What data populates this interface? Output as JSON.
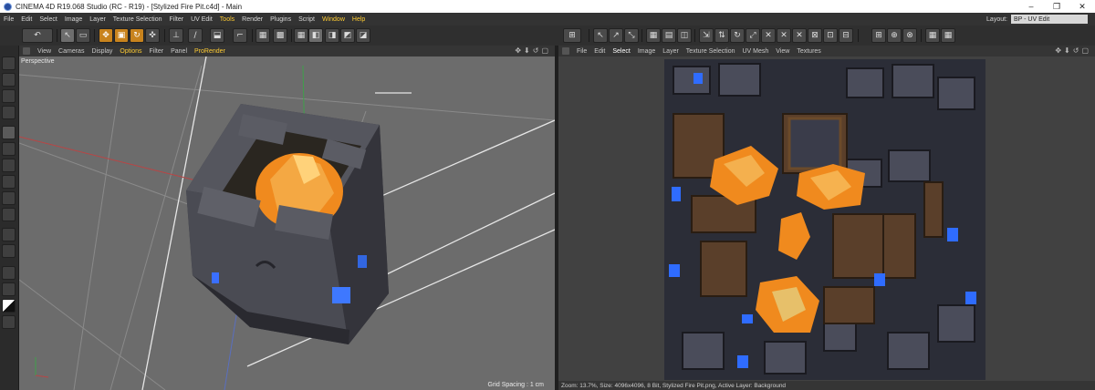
{
  "window": {
    "title": "CINEMA 4D R19.068 Studio (RC - R19) - [Stylized Fire Pit.c4d] - Main",
    "minimize_glyph": "–",
    "maximize_glyph": "❐",
    "close_glyph": "✕"
  },
  "menubar": {
    "items": [
      "File",
      "Edit",
      "Select",
      "Image",
      "Layer",
      "Texture Selection",
      "Filter",
      "UV Edit",
      "Tools",
      "Render",
      "Plugins",
      "Script",
      "Window",
      "Help"
    ],
    "highlighted": [
      "Tools",
      "Window",
      "Help"
    ],
    "layout_label": "Layout:",
    "layout_value": "BP - UV Edit"
  },
  "viewport": {
    "menu": [
      "View",
      "Cameras",
      "Display",
      "Options",
      "Filter",
      "Panel",
      "ProRender"
    ],
    "highlighted": [
      "Options",
      "ProRender"
    ],
    "camera_label": "Perspective",
    "grid_spacing": "Grid Spacing : 1 cm",
    "corner_icons": "✥⬇↺▢"
  },
  "uv_editor": {
    "menu": [
      "File",
      "Edit",
      "Select",
      "Image",
      "Layer",
      "Texture Selection",
      "UV Mesh",
      "View",
      "Textures"
    ],
    "highlighted": [
      "Select"
    ],
    "corner_icons": "✥⬇↺▢",
    "status": "Zoom: 13.7%, Size: 4096x4096, 8 Bit, Stylized Fire Pit.png, Active Layer: Background"
  },
  "colors": {
    "accent": "#c8831d",
    "highlight_text": "#ffcc33",
    "viewport_bg": "#6c6c6c",
    "fire": "#f08a1e"
  }
}
